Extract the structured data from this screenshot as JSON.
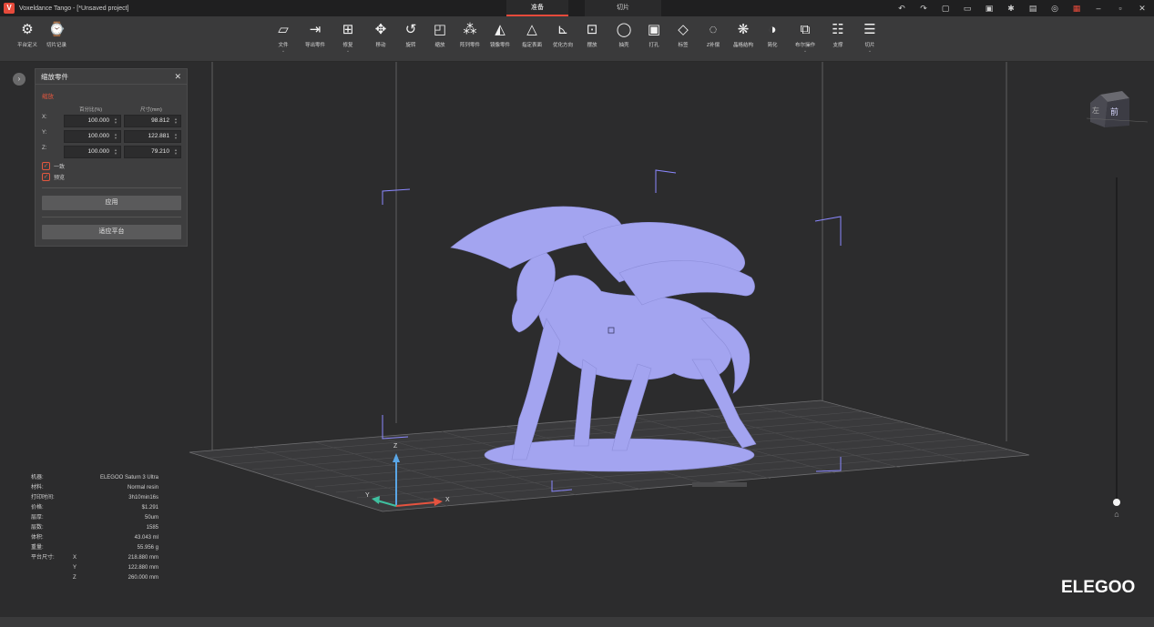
{
  "window": {
    "title": "Voxeldance Tango - [*Unsaved project]",
    "mode_tabs": [
      "准备",
      "切片"
    ],
    "active_mode": "准备"
  },
  "title_icons": [
    "undo-icon",
    "redo-icon",
    "new-file-icon",
    "open-folder-icon",
    "save-icon",
    "settings-icon",
    "feedback-icon",
    "account-icon",
    "printer-icon",
    "minimize-icon",
    "maximize-icon",
    "close-icon"
  ],
  "left_tools": [
    {
      "label": "平台定义",
      "icon": "printer-settings-icon"
    },
    {
      "label": "切片记录",
      "icon": "slice-history-icon"
    }
  ],
  "toolbar": [
    {
      "label": "文件",
      "icon": "folder-icon",
      "caret": true
    },
    {
      "label": "导出零件",
      "icon": "export-icon",
      "caret": false
    },
    {
      "label": "修复",
      "icon": "repair-icon",
      "caret": true
    },
    {
      "label": "移动",
      "icon": "move-icon",
      "caret": false
    },
    {
      "label": "旋转",
      "icon": "rotate-icon",
      "caret": false
    },
    {
      "label": "缩放",
      "icon": "scale-icon",
      "caret": false
    },
    {
      "label": "阵列零件",
      "icon": "array-icon",
      "caret": false
    },
    {
      "label": "镜像零件",
      "icon": "mirror-icon",
      "caret": false
    },
    {
      "label": "指定表面",
      "icon": "surface-icon",
      "caret": false
    },
    {
      "label": "优化方向",
      "icon": "orientation-icon",
      "caret": false
    },
    {
      "label": "摆放",
      "icon": "place-icon",
      "caret": false
    },
    {
      "label": "抽壳",
      "icon": "hollow-icon",
      "caret": false
    },
    {
      "label": "打孔",
      "icon": "punch-hole-icon",
      "caret": false
    },
    {
      "label": "标签",
      "icon": "label-icon",
      "caret": false
    },
    {
      "label": "Z补偿",
      "icon": "z-compensation-icon",
      "caret": false
    },
    {
      "label": "晶格结构",
      "icon": "lattice-icon",
      "caret": false
    },
    {
      "label": "简化",
      "icon": "simplify-icon",
      "caret": false
    },
    {
      "label": "布尔操作",
      "icon": "boolean-icon",
      "caret": true
    },
    {
      "label": "支撑",
      "icon": "support-icon",
      "caret": false
    },
    {
      "label": "切片",
      "icon": "slice-icon",
      "caret": true
    }
  ],
  "scale_panel": {
    "title": "缩放零件",
    "section": "缩放",
    "col_percent": "百分比(%)",
    "col_size": "尺寸(mm)",
    "rows": [
      {
        "axis": "X:",
        "percent": "100.000",
        "size": "98.812"
      },
      {
        "axis": "Y:",
        "percent": "100.000",
        "size": "122.881"
      },
      {
        "axis": "Z:",
        "percent": "100.000",
        "size": "79.210"
      }
    ],
    "uniform_label": "一致",
    "preview_label": "预览",
    "uniform_checked": true,
    "preview_checked": true,
    "apply_label": "应用",
    "fit_label": "适应平台"
  },
  "info": {
    "machine_key": "机器:",
    "machine": "ELEGOO Saturn 3 Ultra",
    "material_key": "材料:",
    "material": "Normal resin",
    "time_key": "打印时间:",
    "time": "3h10min16s",
    "price_key": "价格:",
    "price": "$1.291",
    "layer_h_key": "层厚:",
    "layer_h": "50um",
    "layers_key": "层数:",
    "layers": "1585",
    "volume_key": "体积:",
    "volume": "43.043 ml",
    "weight_key": "重量:",
    "weight": "55.956 g",
    "platform_key": "平台尺寸:",
    "platform_x_axis": "X",
    "platform_x": "218.880 mm",
    "platform_y_axis": "Y",
    "platform_y": "122.880 mm",
    "platform_z_axis": "Z",
    "platform_z": "260.000 mm"
  },
  "viewcube": {
    "front": "前",
    "left": "左"
  },
  "axes": {
    "x": "X",
    "y": "Y",
    "z": "Z"
  },
  "brand": "ELEGOO",
  "colors": {
    "accent": "#e64a3b",
    "model": "#a3a4f0",
    "x_axis": "#e5533f",
    "y_axis": "#3fbf9f",
    "z_axis": "#5aa6e6",
    "frame": "#8b88ff"
  }
}
